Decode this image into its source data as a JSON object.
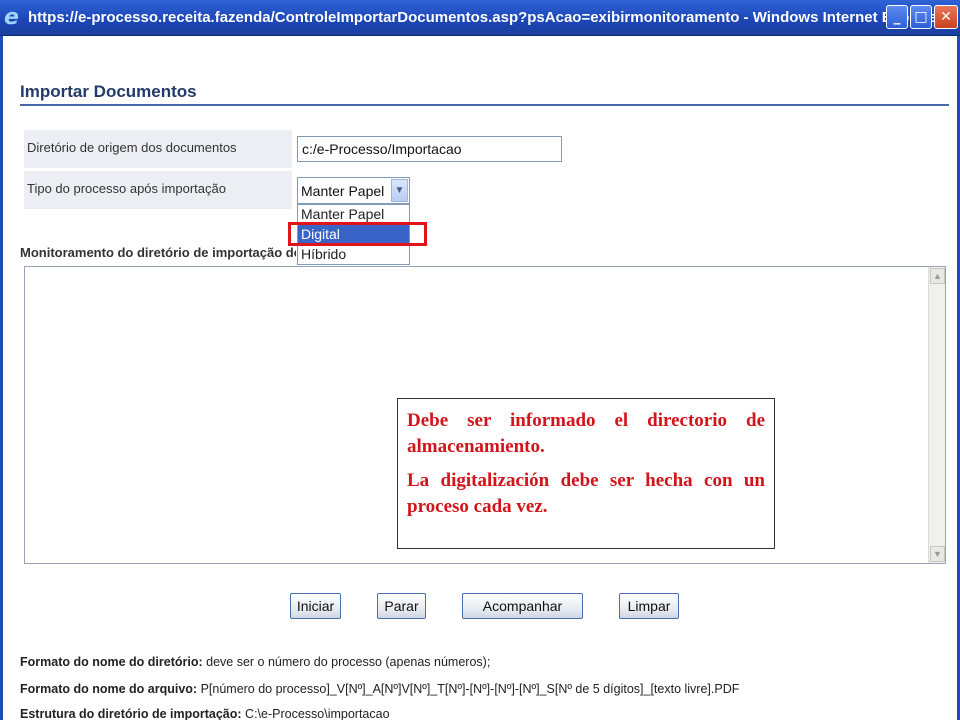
{
  "window": {
    "title": "https://e-processo.receita.fazenda/ControleImportarDocumentos.asp?psAcao=exibirmonitoramento - Windows Internet Explorer",
    "icon": "ie-logo-icon",
    "minimize_glyph": "_",
    "maximize_glyph": "□",
    "close_glyph": "✕"
  },
  "page": {
    "title": "Importar Documentos"
  },
  "form": {
    "dir_label": "Diretório de origem dos documentos",
    "dir_value": "c:/e-Processo/Importacao",
    "tipo_label": "Tipo do processo após importação",
    "tipo_selected": "Manter Papel",
    "tipo_options": [
      "Manter Papel",
      "Digital",
      "Híbrido"
    ],
    "monitor_label": "Monitoramento do diretório de importação de d"
  },
  "note": {
    "line1": "Debe ser informado el directorio de almacenamiento.",
    "line2": "La digitalización debe ser hecha con un proceso cada vez.",
    "color": "#d2141b"
  },
  "buttons": {
    "iniciar": "Iniciar",
    "parar": "Parar",
    "acompanhar": "Acompanhar",
    "limpar": "Limpar"
  },
  "info": {
    "dir_format_label": "Formato do nome do diretório:",
    "dir_format_value": " deve ser o número do processo (apenas números);",
    "file_format_label": "Formato do nome do arquivo:",
    "file_format_value": " P[número do processo]_V[Nº]_A[Nº]V[Nº]_T[Nº]-[Nº]-[Nº]-[Nº]_S[Nº de 5 dígitos]_[texto livre].PDF",
    "structure_label": "Estrutura do diretório de importação:",
    "structure_value": " C:\\e-Processo\\importacao"
  },
  "colors": {
    "titlebar": "#1c47b8",
    "highlight": "#e2141b",
    "selected_option": "#3a63c8"
  }
}
